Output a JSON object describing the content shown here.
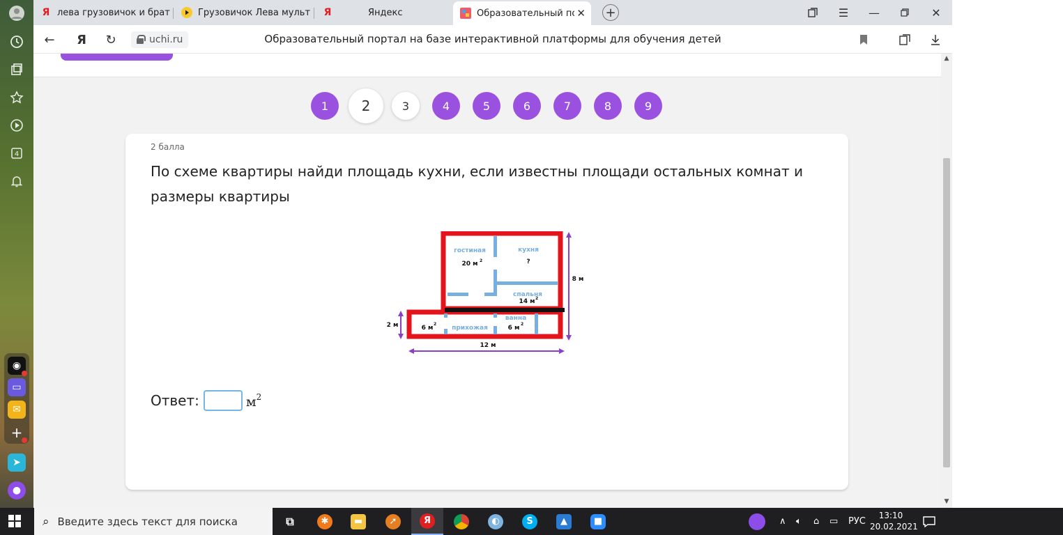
{
  "browser": {
    "tabs": [
      {
        "title": "лева грузовичок и братик",
        "favicon": "yandex-icon"
      },
      {
        "title": "Грузовичок Лева мультик",
        "favicon": "play-icon"
      },
      {
        "title": "Яндекс",
        "favicon": "yandex-icon"
      },
      {
        "title": "Образовательный порт",
        "favicon": "uchi-icon",
        "active": true
      }
    ],
    "new_tab": "+",
    "url": "uchi.ru",
    "page_title": "Образовательный портал на базе интерактивной платформы для обучения детей",
    "yandex_letter": "Я"
  },
  "pager": {
    "pages": [
      "1",
      "2",
      "3",
      "4",
      "5",
      "6",
      "7",
      "8",
      "9"
    ],
    "current": "2",
    "done": [
      "3"
    ]
  },
  "task": {
    "points": "2 балла",
    "question": "По схеме квартиры найди площадь кухни, если известны площади остальных комнат и размеры квартиры",
    "answer_label": "Ответ:",
    "unit": "м",
    "unit_power": "2"
  },
  "scheme": {
    "rooms": {
      "living": {
        "name": "гостиная",
        "area": "20 м"
      },
      "kitchen": {
        "name": "кухня",
        "area": "?"
      },
      "bedroom": {
        "name": "спальня",
        "area": "14 м"
      },
      "hall": {
        "name": "прихожая",
        "area": ""
      },
      "bath": {
        "name": "ванна",
        "area": "6 м"
      },
      "small": {
        "area": "6 м"
      }
    },
    "sup": "2",
    "dims": {
      "height_total": "8 м",
      "height_lower": "2 м",
      "width": "12 м"
    },
    "colors": {
      "wall": "#e3141b",
      "partition": "#78aee0",
      "dimension": "#8b3fc8",
      "label": "#78aee0"
    }
  },
  "taskbar": {
    "search_placeholder": "Введите здесь текст для поиска",
    "lang": "РУС",
    "time": "13:10",
    "date": "20.02.2021"
  },
  "colors": {
    "accent": "#9b51e0",
    "page_bg": "#f2f2f2"
  }
}
